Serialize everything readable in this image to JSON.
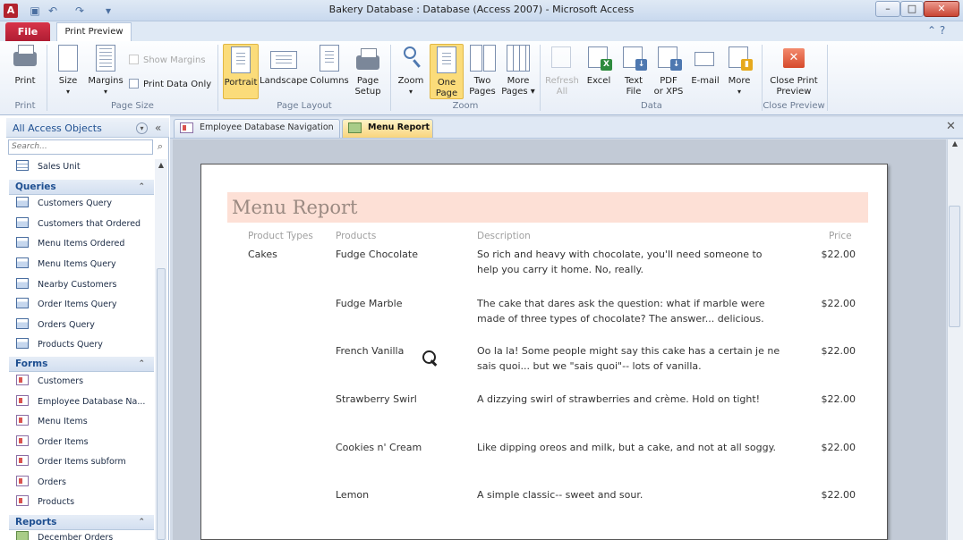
{
  "window": {
    "title": "Bakery Database : Database (Access 2007)  -  Microsoft Access",
    "app_icon": "A",
    "minimize": "–",
    "maximize": "□",
    "close": "✕"
  },
  "ribbon": {
    "file_tab": "File",
    "active_tab": "Print Preview",
    "help": "⌃ ?",
    "buttons": {
      "print": "Print",
      "size": "Size",
      "margins": "Margins",
      "show_margins": "Show Margins",
      "print_data_only": "Print Data Only",
      "portrait": "Portrait",
      "landscape": "Landscape",
      "columns": "Columns",
      "page_setup_1": "Page",
      "page_setup_2": "Setup",
      "zoom": "Zoom",
      "one_page_1": "One",
      "one_page_2": "Page",
      "two_pages_1": "Two",
      "two_pages_2": "Pages",
      "more_pages_1": "More",
      "more_pages_2": "Pages ▾",
      "refresh_1": "Refresh",
      "refresh_2": "All",
      "excel": "Excel",
      "text_file_1": "Text",
      "text_file_2": "File",
      "pdf_1": "PDF",
      "pdf_2": "or XPS",
      "email": "E-mail",
      "more": "More",
      "close_preview_1": "Close Print",
      "close_preview_2": "Preview"
    },
    "groups": {
      "print": "Print",
      "page_size": "Page Size",
      "page_layout": "Page Layout",
      "zoom": "Zoom",
      "data": "Data",
      "close_preview": "Close Preview"
    }
  },
  "nav": {
    "title": "All Access Objects",
    "search_placeholder": "Search...",
    "top_item": "Sales Unit",
    "sections": {
      "queries": "Queries",
      "forms": "Forms",
      "reports": "Reports"
    },
    "queries": [
      "Customers Query",
      "Customers that Ordered",
      "Menu Items Ordered",
      "Menu Items Query",
      "Nearby Customers",
      "Order Items Query",
      "Orders Query",
      "Products Query"
    ],
    "forms": [
      "Customers",
      "Employee Database Na...",
      "Menu Items",
      "Order Items",
      "Order Items  subform",
      "Orders",
      "Products"
    ],
    "reports": [
      "December Orders"
    ]
  },
  "tabs": {
    "tab1": "Employee Database Navigation",
    "tab2": "Menu Report",
    "close": "✕"
  },
  "report": {
    "title": "Menu Report",
    "headers": {
      "type": "Product Types",
      "product": "Products",
      "description": "Description",
      "price": "Price"
    },
    "rows": [
      {
        "type": "Cakes",
        "product": "Fudge Chocolate",
        "description": "So rich and heavy with chocolate, you'll need someone to help you carry it home. No, really.",
        "price": "$22.00"
      },
      {
        "type": "",
        "product": "Fudge Marble",
        "description": "The cake that dares ask the question: what if marble were made of three types of chocolate? The answer... delicious.",
        "price": "$22.00"
      },
      {
        "type": "",
        "product": "French Vanilla",
        "description": "Oo la la! Some people might say this cake has a certain je ne sais quoi... but we \"sais quoi\"-- lots of vanilla.",
        "price": "$22.00"
      },
      {
        "type": "",
        "product": "Strawberry Swirl",
        "description": "A dizzying swirl of strawberries and crème. Hold on tight!",
        "price": "$22.00"
      },
      {
        "type": "",
        "product": "Cookies n' Cream",
        "description": "Like dipping oreos and milk, but a cake, and not at all soggy.",
        "price": "$22.00"
      },
      {
        "type": "",
        "product": "Lemon",
        "description": "A simple classic-- sweet and sour.",
        "price": "$22.00"
      }
    ]
  },
  "colors": {
    "title_band": "#fde0d6",
    "active_ribbon_button": "#fbdc7a",
    "file_tab": "#b01d33"
  }
}
